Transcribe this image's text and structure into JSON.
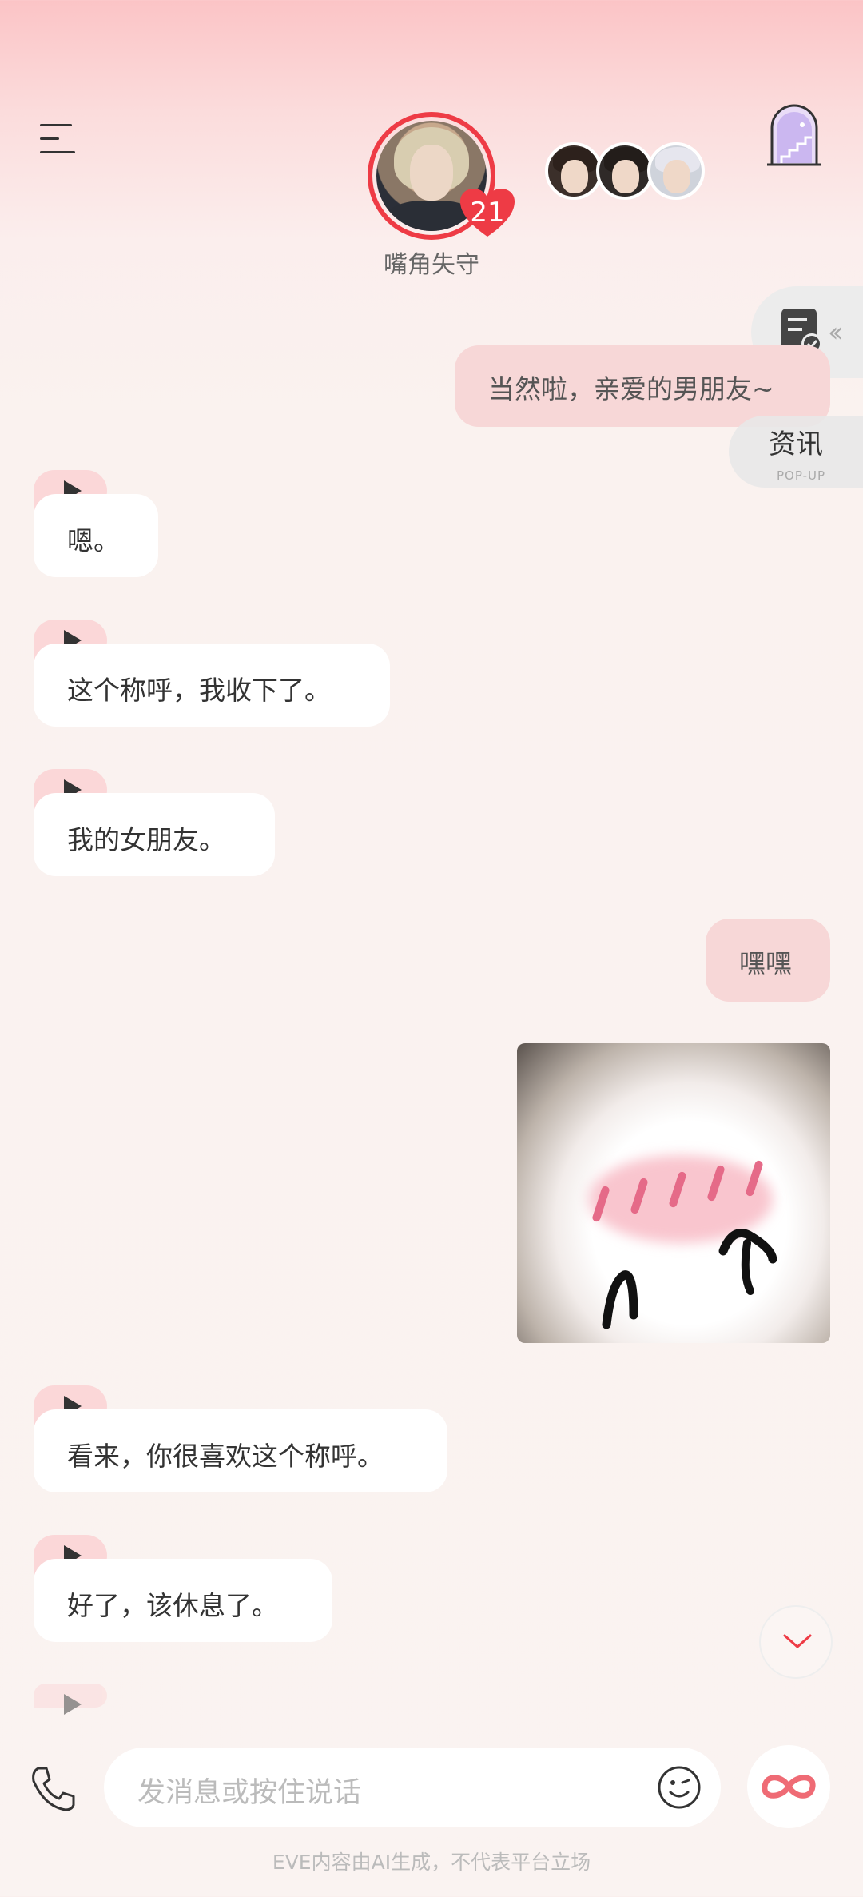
{
  "header": {
    "character_name": "嘴角失守",
    "affection_count": "21"
  },
  "side": {
    "popup_title": "资讯",
    "popup_sub": "POP-UP"
  },
  "messages": [
    {
      "role": "user",
      "text": "当然啦，亲爱的男朋友~"
    },
    {
      "role": "bot",
      "text": "嗯。"
    },
    {
      "role": "bot",
      "text": "这个称呼，我收下了。"
    },
    {
      "role": "bot",
      "text": "我的女朋友。"
    },
    {
      "role": "user",
      "text": "嘿嘿"
    },
    {
      "role": "user",
      "type": "sticker"
    },
    {
      "role": "bot",
      "text": "看来，你很喜欢这个称呼。"
    },
    {
      "role": "bot",
      "text": "好了，该休息了。"
    }
  ],
  "input": {
    "placeholder": "发消息或按住说话"
  },
  "footer": {
    "note": "EVE内容由AI生成，不代表平台立场"
  },
  "colors": {
    "accent": "#ee3b45",
    "user_bubble": "#f7d7d7",
    "bot_bubble": "#ffffff",
    "play_pill": "#fbd7d8"
  }
}
